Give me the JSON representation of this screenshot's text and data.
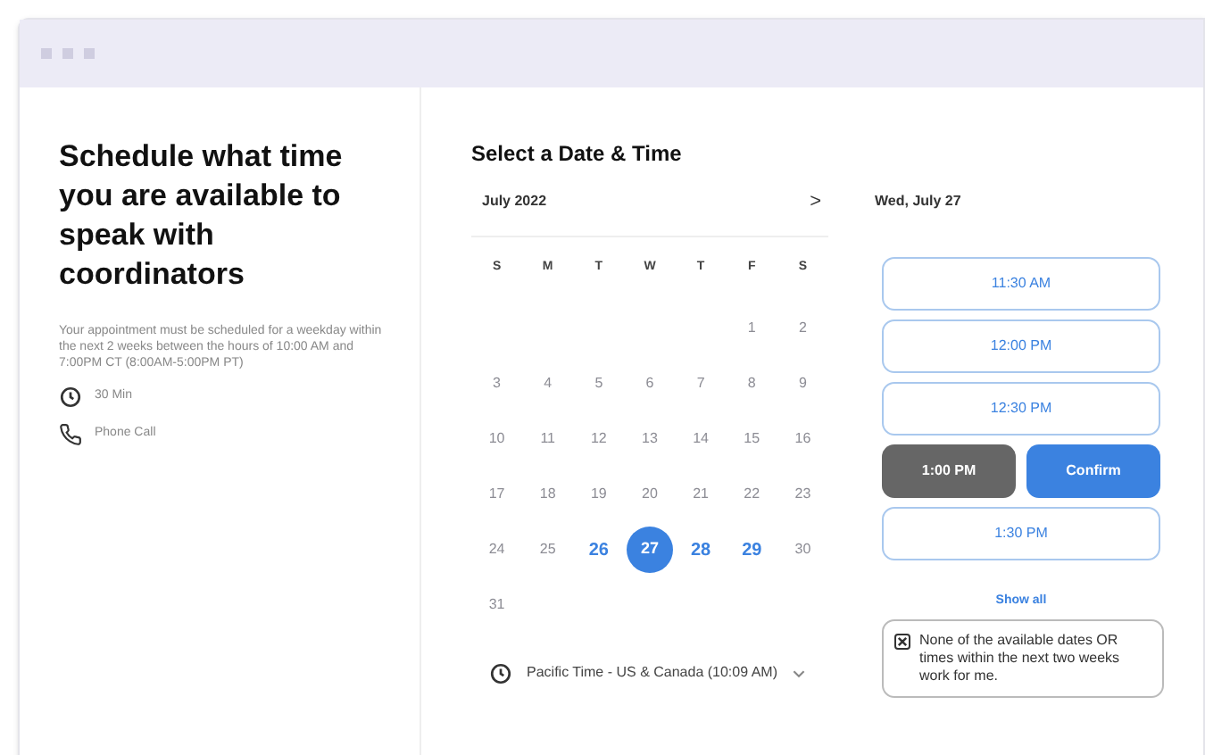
{
  "left": {
    "title": "Schedule what time you are available to speak with coordinators",
    "description": "Your appointment must be scheduled for a weekday within the next 2 weeks between the hours of 10:00 AM and 7:00PM CT (8:00AM-5:00PM PT)",
    "details": [
      {
        "kind": "duration",
        "text": "30 Min"
      },
      {
        "kind": "phone",
        "text": "Phone Call"
      }
    ]
  },
  "calendar": {
    "heading": "Select a Date & Time",
    "month": "July 2022",
    "next": ">",
    "weekdays": [
      "S",
      "M",
      "T",
      "W",
      "T",
      "F",
      "S"
    ],
    "weeks": [
      [
        {
          "label": "1",
          "disabled": true,
          "selected": false
        },
        {
          "label": "2",
          "disabled": true,
          "selected": false
        }
      ],
      [
        {
          "label": "3",
          "disabled": true,
          "selected": false
        },
        {
          "label": "4",
          "disabled": true,
          "selected": false
        },
        {
          "label": "5",
          "disabled": true,
          "selected": false
        },
        {
          "label": "6",
          "disabled": true,
          "selected": false
        },
        {
          "label": "7",
          "disabled": true,
          "selected": false
        },
        {
          "label": "8",
          "disabled": true,
          "selected": false
        },
        {
          "label": "9",
          "disabled": true,
          "selected": false
        }
      ],
      [
        {
          "label": "10",
          "disabled": true,
          "selected": false
        },
        {
          "label": "11",
          "disabled": true,
          "selected": false
        },
        {
          "label": "12",
          "disabled": true,
          "selected": false
        },
        {
          "label": "13",
          "disabled": true,
          "selected": false
        },
        {
          "label": "14",
          "disabled": true,
          "selected": false
        },
        {
          "label": "15",
          "disabled": true,
          "selected": false
        },
        {
          "label": "16",
          "disabled": true,
          "selected": false
        }
      ],
      [
        {
          "label": "17",
          "disabled": true,
          "selected": false
        },
        {
          "label": "18",
          "disabled": true,
          "selected": false
        },
        {
          "label": "19",
          "disabled": true,
          "selected": false
        },
        {
          "label": "20",
          "disabled": true,
          "selected": false
        },
        {
          "label": "21",
          "disabled": true,
          "selected": false
        },
        {
          "label": "22",
          "disabled": true,
          "selected": false
        },
        {
          "label": "23",
          "disabled": true,
          "selected": false
        }
      ],
      [
        {
          "label": "24",
          "disabled": true,
          "selected": false
        },
        {
          "label": "25",
          "disabled": true,
          "selected": false
        },
        {
          "label": "26",
          "disabled": false,
          "selected": false
        },
        {
          "label": "27",
          "disabled": false,
          "selected": true
        },
        {
          "label": "28",
          "disabled": false,
          "selected": false
        },
        {
          "label": "29",
          "disabled": false,
          "selected": false
        },
        {
          "label": "30",
          "disabled": true,
          "selected": false
        }
      ],
      [
        {
          "label": "31",
          "disabled": true,
          "selected": false
        }
      ]
    ],
    "timezone": "Pacific Time - US & Canada (10:09 AM)"
  },
  "times": {
    "date": "Wed, July 27",
    "slots": [
      {
        "label": "11:30 AM",
        "selected": false
      },
      {
        "label": "12:00 PM",
        "selected": false
      },
      {
        "label": "12:30 PM",
        "selected": false
      },
      {
        "label": "1:00 PM",
        "selected": true
      },
      {
        "label": "1:30 PM",
        "selected": false
      }
    ],
    "confirm": "Confirm",
    "show_all": "Show all",
    "none_option": {
      "text": "None of the available dates OR times within the next two weeks work for me.",
      "checked": true
    }
  }
}
